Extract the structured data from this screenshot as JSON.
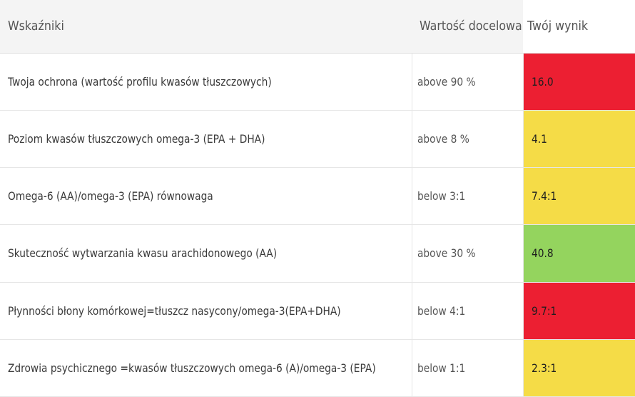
{
  "table": {
    "headers": {
      "indicator": "Wskaźniki",
      "target": "Wartość docelowa",
      "score": "Twój wynik"
    },
    "rows": [
      {
        "indicator": "Twoja ochrona (wartość profilu kwasów tłuszczowych)",
        "target": "above 90 %",
        "score": "16.0",
        "status": "red"
      },
      {
        "indicator": "Poziom kwasów tłuszczowych omega-3 (EPA + DHA)",
        "target": "above 8 %",
        "score": "4.1",
        "status": "yellow"
      },
      {
        "indicator": "Omega-6 (AA)/omega-3 (EPA) równowaga",
        "target": "below 3:1",
        "score": "7.4:1",
        "status": "yellow"
      },
      {
        "indicator": "Skuteczność wytwarzania kwasu arachidonowego (AA)",
        "target": "above 30 %",
        "score": "40.8",
        "status": "green"
      },
      {
        "indicator": "Płynności błony komórkowej=tłuszcz nasycony/omega-3(EPA+DHA)",
        "target": "below 4:1",
        "score": "9.7:1",
        "status": "red"
      },
      {
        "indicator": "Zdrowia psychicznego =kwasów tłuszczowych omega-6 (A)/omega-3 (EPA)",
        "target": "below 1:1",
        "score": "2.3:1",
        "status": "yellow"
      }
    ]
  },
  "status_colors": {
    "red": "#ec1f32",
    "yellow": "#f5dc47",
    "green": "#94d45e"
  }
}
